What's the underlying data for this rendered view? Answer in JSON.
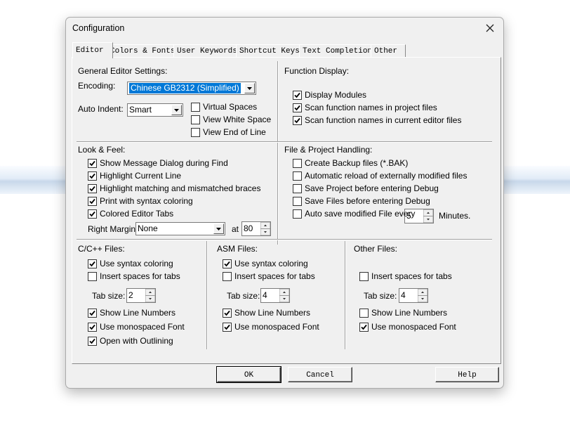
{
  "window": {
    "title": "Configuration"
  },
  "tabs": [
    {
      "label": "Editor"
    },
    {
      "label": "Colors & Fonts"
    },
    {
      "label": "User Keywords"
    },
    {
      "label": "Shortcut Keys"
    },
    {
      "label": "Text Completion"
    },
    {
      "label": "Other"
    }
  ],
  "general": {
    "title": "General Editor Settings:",
    "encoding_label": "Encoding:",
    "encoding_value": "Chinese GB2312 (Simplified)",
    "auto_indent_label": "Auto Indent:",
    "auto_indent_value": "Smart",
    "options": [
      {
        "label": "Virtual Spaces",
        "checked": false
      },
      {
        "label": "View White Space",
        "checked": false
      },
      {
        "label": "View End of Line",
        "checked": false
      }
    ]
  },
  "function_display": {
    "title": "Function Display:",
    "options": [
      {
        "label": "Display Modules",
        "checked": true
      },
      {
        "label": "Scan function names in project files",
        "checked": true
      },
      {
        "label": "Scan function names in current editor files",
        "checked": true
      }
    ]
  },
  "look_feel": {
    "title": "Look & Feel:",
    "options": [
      {
        "label": "Show Message Dialog during Find",
        "checked": true
      },
      {
        "label": "Highlight Current Line",
        "checked": true
      },
      {
        "label": "Highlight matching and mismatched braces",
        "checked": true
      },
      {
        "label": "Print with syntax coloring",
        "checked": true
      },
      {
        "label": "Colored Editor Tabs",
        "checked": true
      }
    ],
    "right_margin_label": "Right Margin:",
    "right_margin_value": "None",
    "at_label": "at",
    "at_value": "80"
  },
  "file_project": {
    "title": "File & Project Handling:",
    "options": [
      {
        "label": "Create Backup files (*.BAK)",
        "checked": false
      },
      {
        "label": "Automatic reload of externally modified files",
        "checked": false
      },
      {
        "label": "Save Project before entering Debug",
        "checked": false
      },
      {
        "label": "Save Files before entering Debug",
        "checked": false
      },
      {
        "label": "Auto save modified File every",
        "checked": false
      }
    ],
    "autosave_value": "5",
    "minutes_label": "Minutes."
  },
  "cpp_files": {
    "title": "C/C++ Files:",
    "syntax": {
      "label": "Use syntax coloring",
      "checked": true
    },
    "insert_spaces": {
      "label": "Insert spaces for tabs",
      "checked": false
    },
    "tab_size_label": "Tab size:",
    "tab_size_value": "2",
    "line_numbers": {
      "label": "Show Line Numbers",
      "checked": true
    },
    "monospaced": {
      "label": "Use monospaced Font",
      "checked": true
    },
    "outlining": {
      "label": "Open with Outlining",
      "checked": true
    }
  },
  "asm_files": {
    "title": "ASM Files:",
    "syntax": {
      "label": "Use syntax coloring",
      "checked": true
    },
    "insert_spaces": {
      "label": "Insert spaces for tabs",
      "checked": false
    },
    "tab_size_label": "Tab size:",
    "tab_size_value": "4",
    "line_numbers": {
      "label": "Show Line Numbers",
      "checked": true
    },
    "monospaced": {
      "label": "Use monospaced Font",
      "checked": true
    }
  },
  "other_files": {
    "title": "Other Files:",
    "insert_spaces": {
      "label": "Insert spaces for tabs",
      "checked": false
    },
    "tab_size_label": "Tab size:",
    "tab_size_value": "4",
    "line_numbers": {
      "label": "Show Line Numbers",
      "checked": false
    },
    "monospaced": {
      "label": "Use monospaced Font",
      "checked": true
    }
  },
  "buttons": {
    "ok": "OK",
    "cancel": "Cancel",
    "help": "Help"
  },
  "colors": {
    "selection": "#0078d7",
    "bg_band": "#dbe6f2"
  }
}
